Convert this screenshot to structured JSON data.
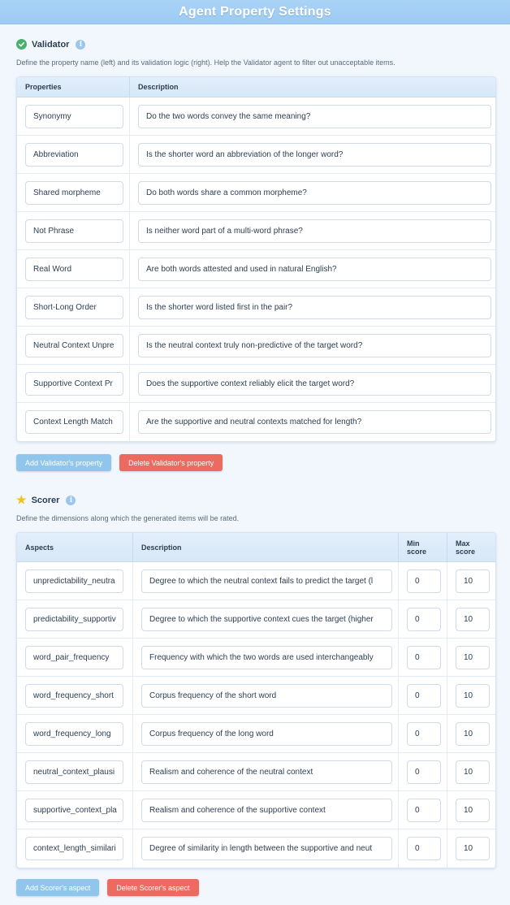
{
  "title": "Agent Property Settings",
  "validator": {
    "heading": "Validator",
    "description": "Define the property name (left) and its validation logic (right). Help the Validator agent to filter out unacceptable items.",
    "col_properties": "Properties",
    "col_description": "Description",
    "rows": [
      {
        "property": "Synonymy",
        "description": "Do the two words convey the same meaning?"
      },
      {
        "property": "Abbreviation",
        "description": "Is the shorter word an abbreviation of the longer word?"
      },
      {
        "property": "Shared morpheme",
        "description": "Do both words share a common morpheme?"
      },
      {
        "property": "Not Phrase",
        "description": "Is neither word part of a multi-word phrase?"
      },
      {
        "property": "Real Word",
        "description": "Are both words attested and used in natural English?"
      },
      {
        "property": "Short-Long Order",
        "description": "Is the shorter word listed first in the pair?"
      },
      {
        "property": "Neutral Context Unpre",
        "description": "Is the neutral context truly non-predictive of the target word?"
      },
      {
        "property": "Supportive Context Pr",
        "description": "Does the supportive context reliably elicit the target word?"
      },
      {
        "property": "Context Length Match",
        "description": "Are the supportive and neutral contexts matched for length?"
      }
    ],
    "add_label": "Add Validator's property",
    "delete_label": "Delete Validator's property"
  },
  "scorer": {
    "heading": "Scorer",
    "description": "Define the dimensions along which the generated items will be rated.",
    "col_aspects": "Aspects",
    "col_description": "Description",
    "col_min_line1": "Min",
    "col_min_line2": "score",
    "col_max_line1": "Max",
    "col_max_line2": "score",
    "rows": [
      {
        "aspect": "unpredictability_neutra",
        "description": "Degree to which the neutral context fails to predict the target (l",
        "min": "0",
        "max": "10"
      },
      {
        "aspect": "predictability_supportiv",
        "description": "Degree to which the supportive context cues the target (higher",
        "min": "0",
        "max": "10"
      },
      {
        "aspect": "word_pair_frequency",
        "description": "Frequency with which the two words are used interchangeably",
        "min": "0",
        "max": "10"
      },
      {
        "aspect": "word_frequency_short",
        "description": "Corpus frequency of the short word",
        "min": "0",
        "max": "10"
      },
      {
        "aspect": "word_frequency_long",
        "description": "Corpus frequency of the long word",
        "min": "0",
        "max": "10"
      },
      {
        "aspect": "neutral_context_plausi",
        "description": "Realism and coherence of the neutral context",
        "min": "0",
        "max": "10"
      },
      {
        "aspect": "supportive_context_pla",
        "description": "Realism and coherence of the supportive context",
        "min": "0",
        "max": "10"
      },
      {
        "aspect": "context_length_similari",
        "description": "Degree of similarity in length between the supportive and neut",
        "min": "0",
        "max": "10"
      }
    ],
    "add_label": "Add Scorer's aspect",
    "delete_label": "Delete Scorer's aspect"
  },
  "icons": {
    "validator": "check-circle-icon",
    "scorer": "star-icon",
    "info": "info-icon"
  },
  "colors": {
    "title_bar": "#a9d2f6",
    "add_button": "#91c6ec",
    "delete_button": "#ec6a60",
    "check": "#4caf6e",
    "star": "#f2c21b"
  }
}
